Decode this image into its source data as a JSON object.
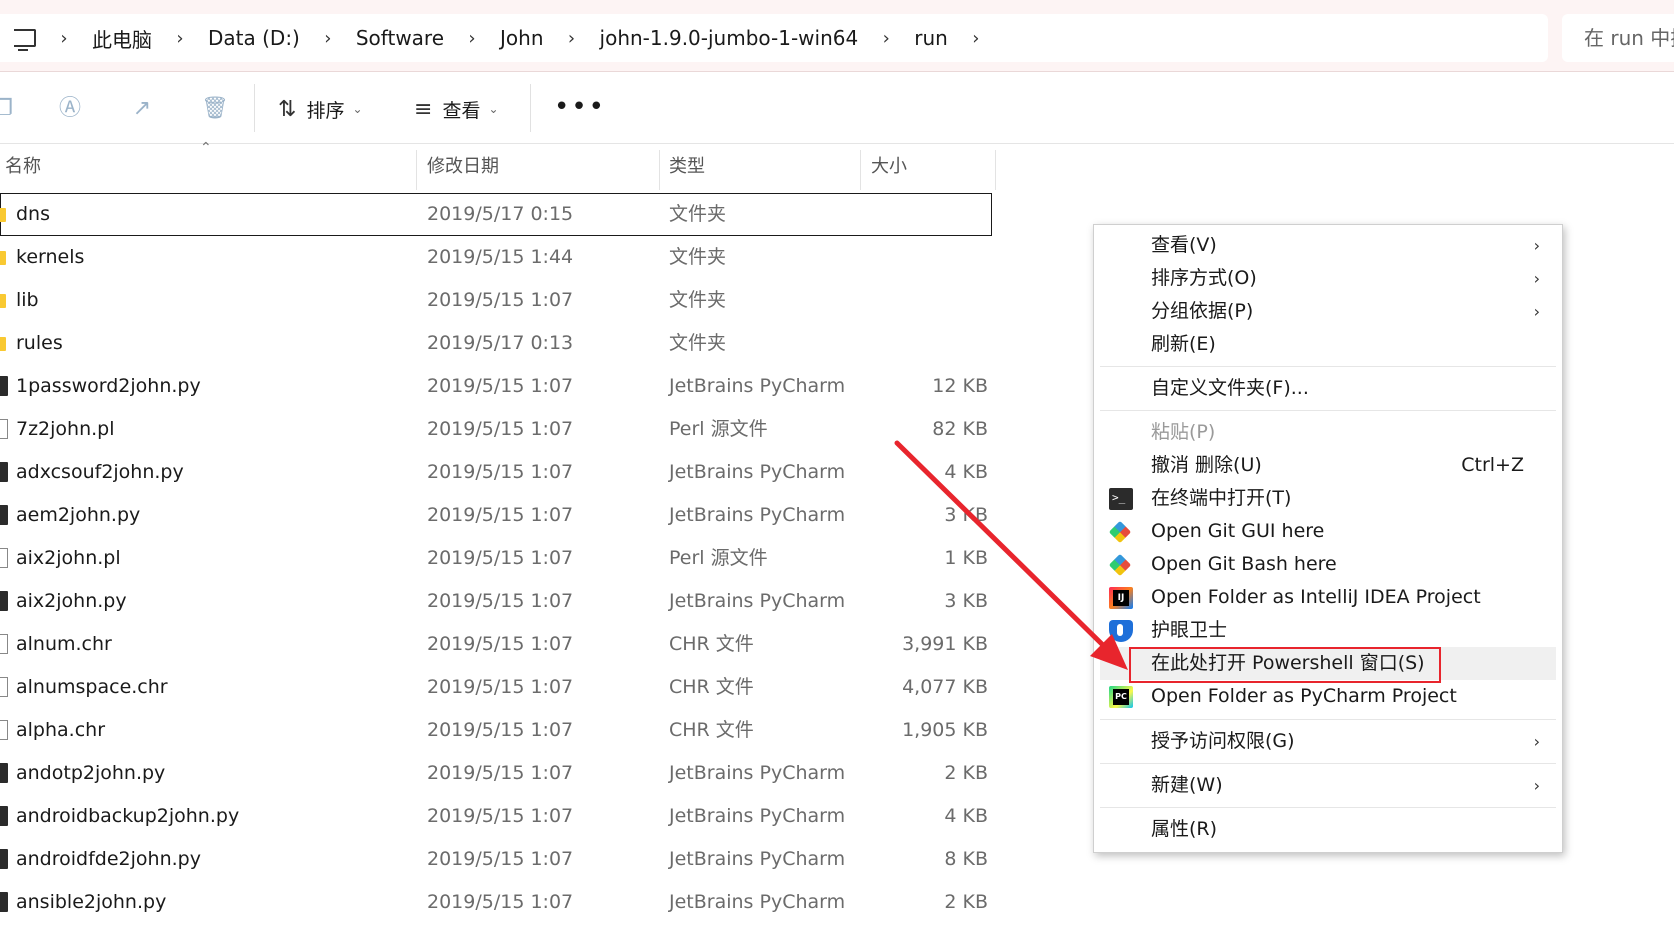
{
  "addressbar": {
    "crumbs": [
      "此电脑",
      "Data (D:)",
      "Software",
      "John",
      "john-1.9.0-jumbo-1-win64",
      "run"
    ],
    "search_placeholder": "在 run 中搜"
  },
  "toolbar": {
    "sort_label": "排序",
    "view_label": "查看",
    "more_label": "•••"
  },
  "columns": {
    "name": "名称",
    "modified": "修改日期",
    "type": "类型",
    "size": "大小"
  },
  "files": [
    {
      "name": "dns",
      "date": "2019/5/17 0:15",
      "type": "文件夹",
      "size": "",
      "icon": "folder-icon"
    },
    {
      "name": "kernels",
      "date": "2019/5/15 1:44",
      "type": "文件夹",
      "size": "",
      "icon": "folder-icon"
    },
    {
      "name": "lib",
      "date": "2019/5/15 1:07",
      "type": "文件夹",
      "size": "",
      "icon": "folder-icon"
    },
    {
      "name": "rules",
      "date": "2019/5/17 0:13",
      "type": "文件夹",
      "size": "",
      "icon": "folder-icon"
    },
    {
      "name": "1password2john.py",
      "date": "2019/5/15 1:07",
      "type": "JetBrains PyCharm",
      "size": "12 KB",
      "icon": "python-file-icon"
    },
    {
      "name": "7z2john.pl",
      "date": "2019/5/15 1:07",
      "type": "Perl 源文件",
      "size": "82 KB",
      "icon": "file-icon"
    },
    {
      "name": "adxcsouf2john.py",
      "date": "2019/5/15 1:07",
      "type": "JetBrains PyCharm",
      "size": "4 KB",
      "icon": "python-file-icon"
    },
    {
      "name": "aem2john.py",
      "date": "2019/5/15 1:07",
      "type": "JetBrains PyCharm",
      "size": "3 KB",
      "icon": "python-file-icon"
    },
    {
      "name": "aix2john.pl",
      "date": "2019/5/15 1:07",
      "type": "Perl 源文件",
      "size": "1 KB",
      "icon": "file-icon"
    },
    {
      "name": "aix2john.py",
      "date": "2019/5/15 1:07",
      "type": "JetBrains PyCharm",
      "size": "3 KB",
      "icon": "python-file-icon"
    },
    {
      "name": "alnum.chr",
      "date": "2019/5/15 1:07",
      "type": "CHR 文件",
      "size": "3,991 KB",
      "icon": "file-icon"
    },
    {
      "name": "alnumspace.chr",
      "date": "2019/5/15 1:07",
      "type": "CHR 文件",
      "size": "4,077 KB",
      "icon": "file-icon"
    },
    {
      "name": "alpha.chr",
      "date": "2019/5/15 1:07",
      "type": "CHR 文件",
      "size": "1,905 KB",
      "icon": "file-icon"
    },
    {
      "name": "andotp2john.py",
      "date": "2019/5/15 1:07",
      "type": "JetBrains PyCharm",
      "size": "2 KB",
      "icon": "python-file-icon"
    },
    {
      "name": "androidbackup2john.py",
      "date": "2019/5/15 1:07",
      "type": "JetBrains PyCharm",
      "size": "4 KB",
      "icon": "python-file-icon"
    },
    {
      "name": "androidfde2john.py",
      "date": "2019/5/15 1:07",
      "type": "JetBrains PyCharm",
      "size": "8 KB",
      "icon": "python-file-icon"
    },
    {
      "name": "ansible2john.py",
      "date": "2019/5/15 1:07",
      "type": "JetBrains PyCharm",
      "size": "2 KB",
      "icon": "python-file-icon"
    }
  ],
  "context_menu": {
    "view": "查看(V)",
    "sort_by": "排序方式(O)",
    "group_by": "分组依据(P)",
    "refresh": "刷新(E)",
    "customize": "自定义文件夹(F)...",
    "paste": "粘贴(P)",
    "undo": "撤消 删除(U)",
    "undo_shortcut": "Ctrl+Z",
    "open_terminal": "在终端中打开(T)",
    "git_gui": "Open Git GUI here",
    "git_bash": "Open Git Bash here",
    "intellij": "Open Folder as IntelliJ IDEA Project",
    "eye_guard": "护眼卫士",
    "powershell": "在此处打开 Powershell 窗口(S)",
    "pycharm": "Open Folder as PyCharm Project",
    "grant_access": "授予访问权限(G)",
    "new": "新建(W)",
    "properties": "属性(R)"
  },
  "colors": {
    "highlight_box": "#e8252d",
    "arrow": "#e8252d",
    "folder": "#f9c932"
  }
}
